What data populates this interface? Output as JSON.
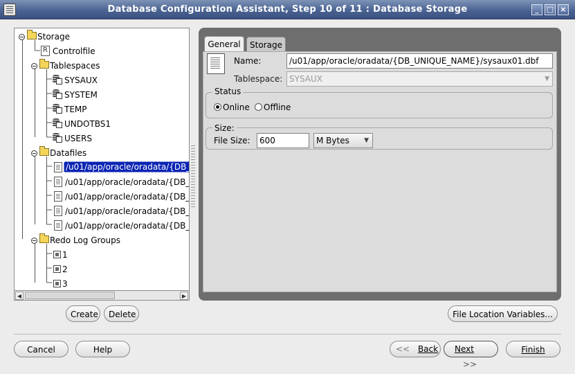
{
  "window": {
    "title": "Database Configuration Assistant, Step 10 of 11 : Database Storage",
    "controls": [
      "_",
      "□",
      "×"
    ]
  },
  "tree": {
    "root": "Storage",
    "controlfile": "Controlfile",
    "tablespaces_label": "Tablespaces",
    "tablespaces": [
      "SYSAUX",
      "SYSTEM",
      "TEMP",
      "UNDOTBS1",
      "USERS"
    ],
    "datafiles_label": "Datafiles",
    "datafiles": [
      "/u01/app/oracle/oradata/{DB_",
      "/u01/app/oracle/oradata/{DB_",
      "/u01/app/oracle/oradata/{DB_",
      "/u01/app/oracle/oradata/{DB_",
      "/u01/app/oracle/oradata/{DB_"
    ],
    "redo_label": "Redo Log Groups",
    "redo_groups": [
      "1",
      "2",
      "3"
    ],
    "selected_index": 0
  },
  "tree_buttons": {
    "create": "Create",
    "delete": "Delete"
  },
  "tabs": {
    "general": "General",
    "storage": "Storage"
  },
  "general": {
    "name_label": "Name:",
    "name_value": "/u01/app/oracle/oradata/{DB_UNIQUE_NAME}/sysaux01.dbf",
    "tablespace_label": "Tablespace:",
    "tablespace_value": "SYSAUX",
    "status_label": "Status",
    "online_label": "Online",
    "offline_label": "Offline",
    "status_selected": "Online",
    "size_group_label": "Size:",
    "file_size_label": "File Size:",
    "file_size_value": "600",
    "unit_value": "M Bytes"
  },
  "file_location_button": "File Location Variables...",
  "footer": {
    "cancel": "Cancel",
    "help": "Help",
    "back": "Back",
    "next": "Next",
    "finish": "Finish"
  }
}
